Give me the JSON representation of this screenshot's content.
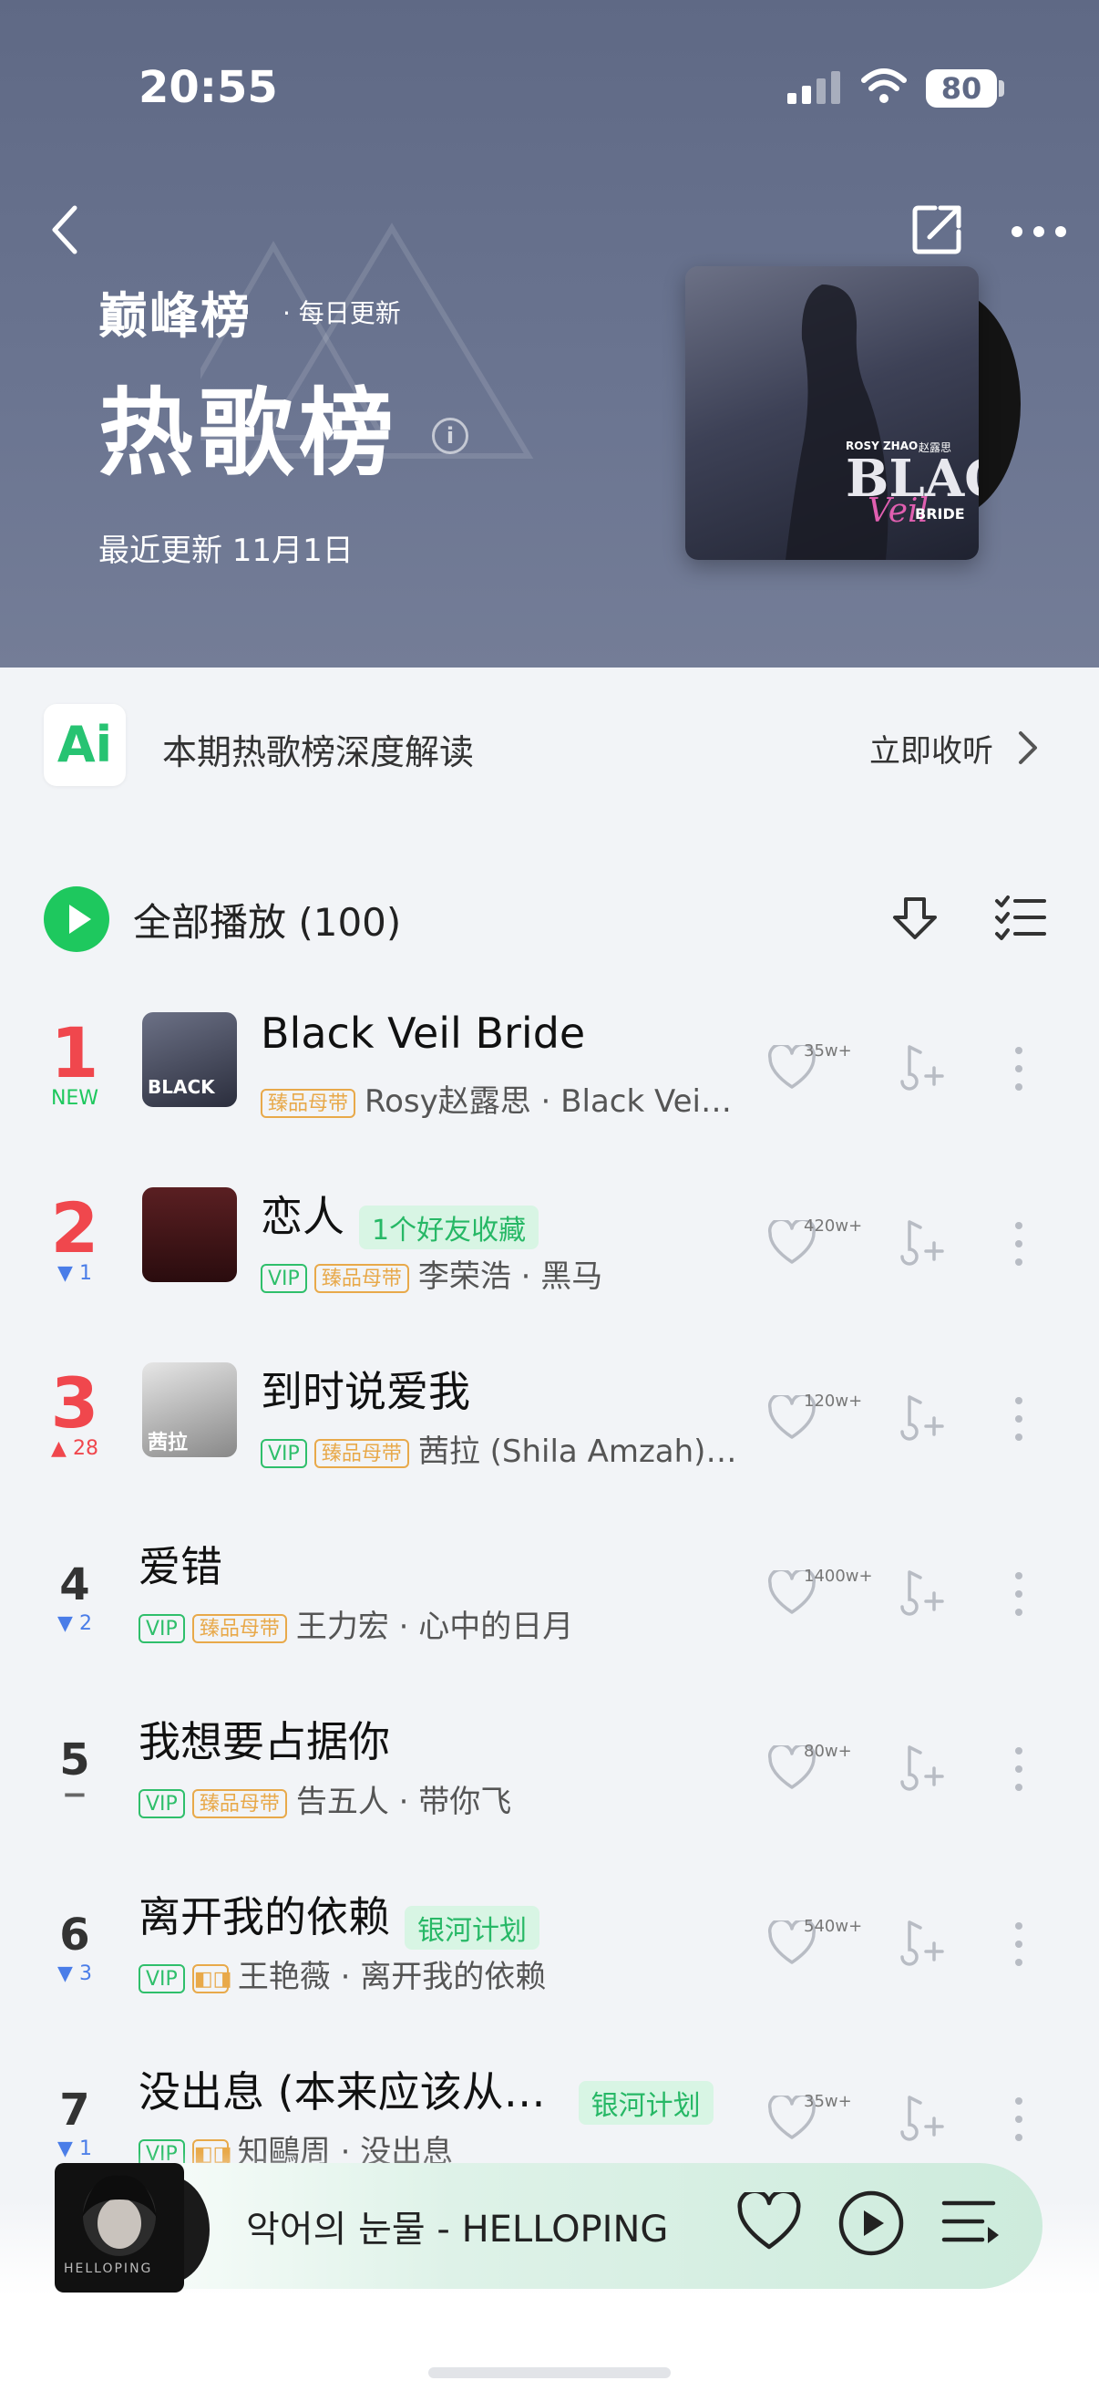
{
  "status_bar": {
    "time": "20:55",
    "battery": "80"
  },
  "header": {
    "brand": "巅峰榜",
    "brand_sub": "· 每日更新",
    "title": "热歌榜",
    "info_icon": "i",
    "updated": "最近更新 11月1日",
    "cover_text": {
      "artist": "ROSY ZHAO",
      "artist_cn": "赵露思",
      "main": "BLACK",
      "script": "Veil",
      "sub": "BRIDE"
    }
  },
  "ai_row": {
    "logo": "Ai",
    "text": "本期热歌榜深度解读",
    "action": "立即收听"
  },
  "play_all": {
    "label": "全部播放 (100)"
  },
  "songs": [
    {
      "rank": "1",
      "change": "NEW",
      "title": "Black Veil Bride",
      "tag": "",
      "vip": "",
      "quality": "臻品母带",
      "dolby": "",
      "artist_album": "Rosy赵露思 · Black Vei…",
      "likes": "35w+",
      "thumb_text": "BLACK"
    },
    {
      "rank": "2",
      "change": "▼ 1",
      "title": "恋人",
      "tag": "1个好友收藏",
      "vip": "VIP",
      "quality": "臻品母带",
      "dolby": "",
      "artist_album": "李荣浩 · 黑马",
      "likes": "420w+",
      "thumb_text": ""
    },
    {
      "rank": "3",
      "change": "▲ 28",
      "title": "到时说爱我",
      "tag": "",
      "vip": "VIP",
      "quality": "臻品母带",
      "dolby": "",
      "artist_album": "茜拉 (Shila Amzah)…",
      "likes": "120w+",
      "thumb_text": "茜拉"
    },
    {
      "rank": "4",
      "change": "▼ 2",
      "title": "爱错",
      "tag": "",
      "vip": "VIP",
      "quality": "臻品母带",
      "dolby": "",
      "artist_album": "王力宏 · 心中的日月",
      "likes": "1400w+",
      "thumb_text": ""
    },
    {
      "rank": "5",
      "change": "−",
      "title": "我想要占据你",
      "tag": "",
      "vip": "VIP",
      "quality": "臻品母带",
      "dolby": "",
      "artist_album": "告五人 · 带你飞",
      "likes": "80w+",
      "thumb_text": ""
    },
    {
      "rank": "6",
      "change": "▼ 3",
      "title": "离开我的依赖",
      "tag": "银河计划",
      "vip": "VIP",
      "quality": "",
      "dolby": "◧◨",
      "artist_album": "王艳薇 · 离开我的依赖",
      "likes": "540w+",
      "thumb_text": ""
    },
    {
      "rank": "7",
      "change": "▼ 1",
      "title": "没出息 (本来应该从…",
      "tag": "银河计划",
      "vip": "VIP",
      "quality": "",
      "dolby": "◧◨",
      "artist_album": "知鷗周 · 没出息",
      "likes": "35w+",
      "thumb_text": ""
    }
  ],
  "mini_player": {
    "title": "악어의 눈물 - HELLOPING",
    "cover_text": "HELLOPING"
  },
  "colors": {
    "accent_green": "#1ec85e",
    "rank_red": "#f0474d",
    "down_blue": "#4a7de8",
    "header_bg": "#6b7591"
  }
}
